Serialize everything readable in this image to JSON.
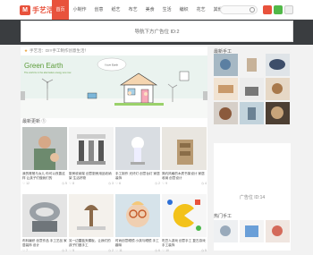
{
  "site": {
    "logo_badge": "M",
    "logo_text": "手艺活"
  },
  "nav": [
    "首页",
    "小制作",
    "创意",
    "纸艺",
    "布艺",
    "美食",
    "生活",
    "编织",
    "花艺",
    "其他"
  ],
  "colors": {
    "accent": "#e8523c",
    "dark_band": "#3a3d40",
    "wechat": "#51b848"
  },
  "header_ad": "导航下方广告位 ID:2",
  "notice": "手艺活：DIY手工制作创意生活！",
  "banner": {
    "title": "Green Earth",
    "subtitle": "The world is in the alternative energy era now",
    "cloud_text": "I love Earth"
  },
  "latest_title": "最新更新 ①",
  "cards": [
    {
      "title": "我的爸爸与女儿 你可以改善这样 让孩子们做我们的",
      "meta_left": "♡ 12",
      "meta_right": "◷ 5"
    },
    {
      "title": "厨房收纳架 创意厨房用品收纳架 生活好物",
      "meta_left": "♡ 8",
      "meta_right": "◷ 3"
    },
    {
      "title": "手工制作 光纤灯 创意台灯 家居装饰",
      "meta_left": "♡ 6",
      "meta_right": "◷ 2"
    },
    {
      "title": "简约风格的木质书架设计 家居收纳 创意设计",
      "meta_left": "♡ 9",
      "meta_right": "◷ 4"
    },
    {
      "title": "布料编织 创意作品 手工艺品 家居装饰 设计",
      "meta_left": "♡ 7",
      "meta_right": "◷ 3"
    },
    {
      "title": "另一边蘑菇夹模板，让我们的孩子们做手工",
      "meta_left": "♡ 5",
      "meta_right": "◷ 2"
    },
    {
      "title": "时尚创意眼镜 小孩与眼镜 手工趣味",
      "meta_left": "♡ 11",
      "meta_right": "◷ 6"
    },
    {
      "title": "吃豆人游戏 创意手工 复古游戏 手工装饰",
      "meta_left": "♡ 10",
      "meta_right": "◷ 5"
    }
  ],
  "sidebar": {
    "top_title": "最新手工",
    "ad_text": "广告位 ID:14",
    "bottom_title": "热门手工"
  }
}
